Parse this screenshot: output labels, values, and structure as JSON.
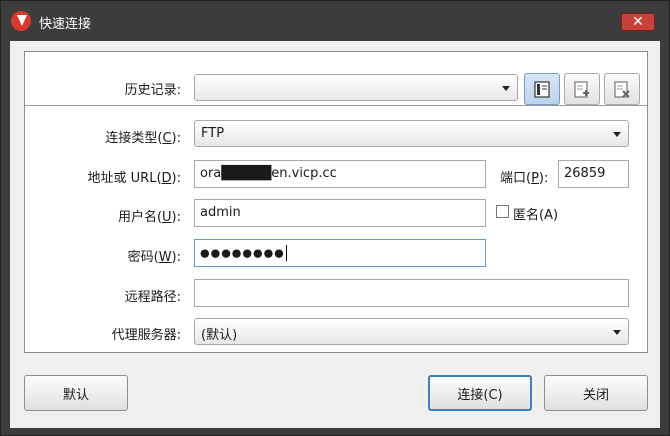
{
  "window": {
    "title": "快速连接"
  },
  "history": {
    "label": "历史记录:",
    "value": ""
  },
  "toolbar": {
    "icons": [
      "quick-connect-icon",
      "add-entry-icon",
      "delete-entry-icon"
    ]
  },
  "connection_type": {
    "label_pre": "连接类型(",
    "label_key": "C",
    "label_post": "):",
    "value": "FTP"
  },
  "address": {
    "label_pre": "地址或 URL(",
    "label_key": "D",
    "label_post": "):",
    "value": "ora█████en.vicp.cc"
  },
  "port": {
    "label_pre": "端口(",
    "label_key": "P",
    "label_post": "):",
    "value": "26859"
  },
  "username": {
    "label_pre": "用户名(",
    "label_key": "U",
    "label_post": "):",
    "value": "admin"
  },
  "anonymous": {
    "label": "匿名(A)",
    "checked": false
  },
  "password": {
    "label_pre": "密码(",
    "label_key": "W",
    "label_post": "):",
    "value": "●●●●●●●●"
  },
  "remote_path": {
    "label": "远程路径:",
    "value": ""
  },
  "proxy": {
    "label": "代理服务器:",
    "value": "(默认)"
  },
  "buttons": {
    "default": "默认",
    "connect": "连接(C)",
    "close": "关闭"
  }
}
